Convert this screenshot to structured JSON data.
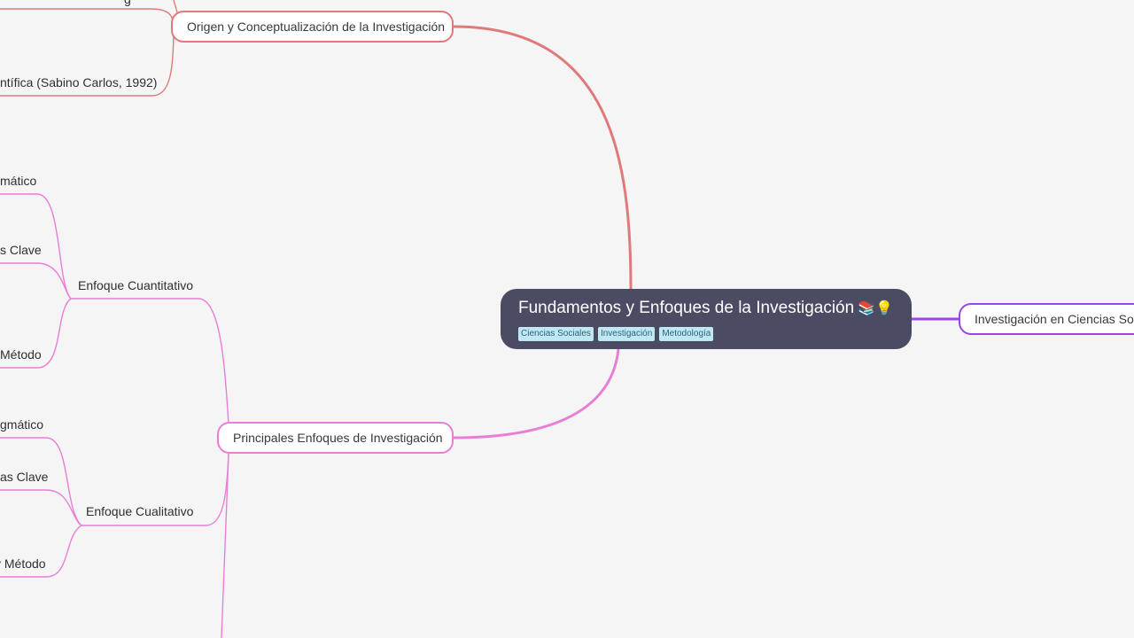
{
  "central": {
    "title": "Fundamentos y Enfoques de la Investigación",
    "emoji": "📚💡",
    "tags": [
      "Ciencias Sociales",
      "Investigación",
      "Metodología"
    ]
  },
  "branches": {
    "origen": {
      "label": "Origen y Conceptualización de la Investigación",
      "color": "#e07a7a",
      "children": {
        "cut_top": "g",
        "sabino": "ntífica (Sabino Carlos, 1992)"
      }
    },
    "enfoques": {
      "label": "Principales Enfoques de Investigación",
      "color": "#e87fd6",
      "cuantitativo": {
        "label": "Enfoque Cuantitativo",
        "children": [
          "mático",
          "s Clave",
          "Método"
        ]
      },
      "cualitativo": {
        "label": "Enfoque Cualitativo",
        "children": [
          "gmático",
          "as Clave",
          "y Método"
        ]
      }
    },
    "sociales": {
      "label": "Investigación en Ciencias Sociales",
      "color": "#9b45e4"
    }
  }
}
